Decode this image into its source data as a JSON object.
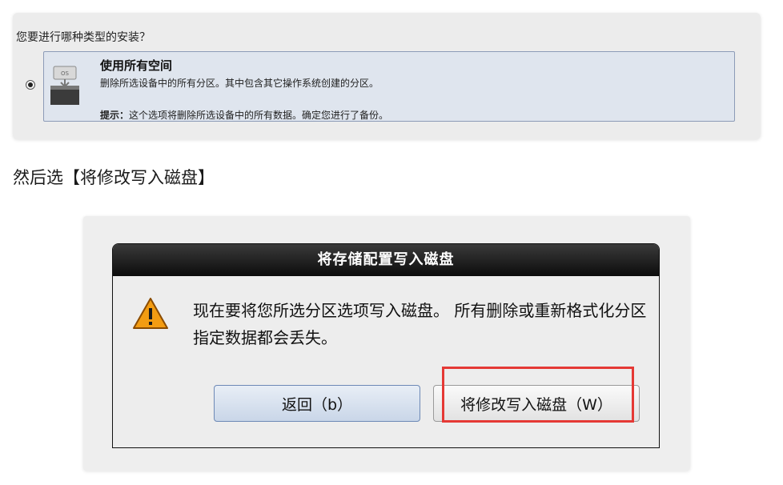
{
  "install_type": {
    "question": "您要进行哪种类型的安装？",
    "option": {
      "icon": "os-disk-icon",
      "title": "使用所有空间",
      "description": "删除所选设备中的所有分区。其中包含其它操作系统创建的分区。",
      "hint_label": "提示：",
      "hint_text": "这个选项将删除所选设备中的所有数据。确定您进行了备份。",
      "selected": true
    }
  },
  "caption": "然后选【将修改写入磁盘】",
  "dialog": {
    "title": "将存储配置写入磁盘",
    "icon": "warning-icon",
    "message": "现在要将您所选分区选项写入磁盘。 所有删除或重新格式化分区指定数据都会丢失。",
    "buttons": {
      "back": "返回（b）",
      "write": "将修改写入磁盘（W）"
    },
    "highlight_color": "#e53935"
  }
}
